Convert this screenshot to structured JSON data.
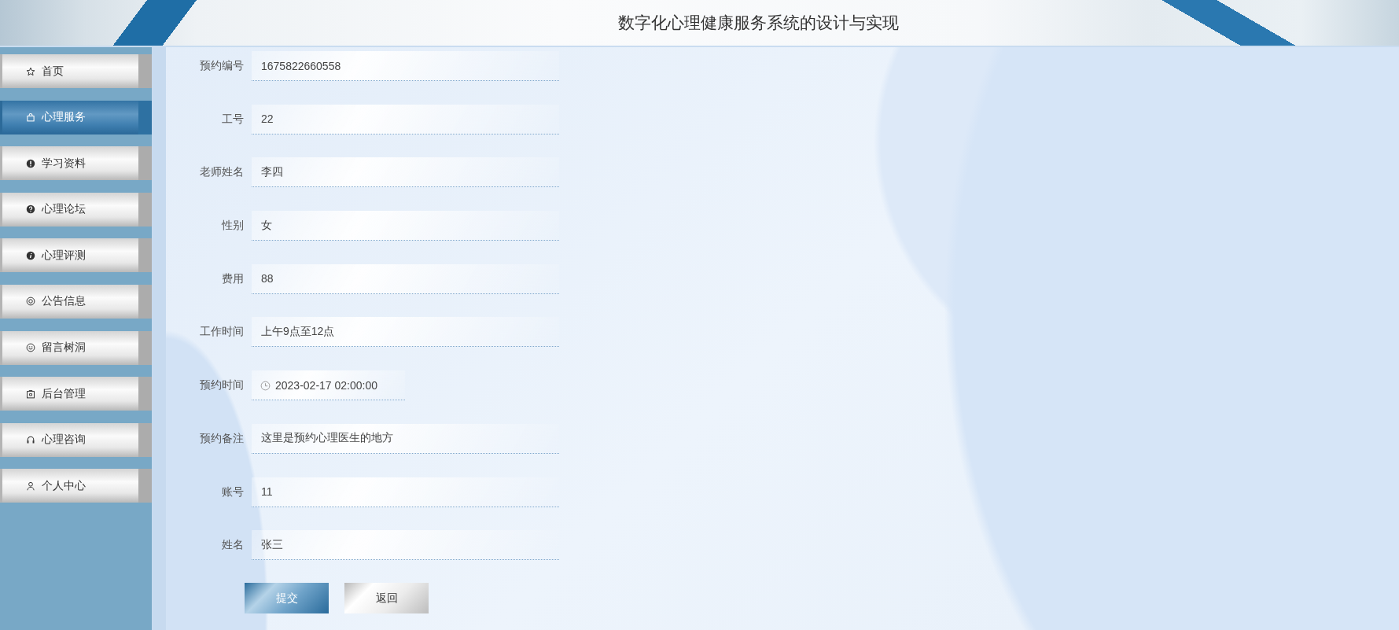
{
  "header": {
    "title": "数字化心理健康服务系统的设计与实现"
  },
  "sidebar": {
    "items": [
      {
        "label": "首页",
        "selected": false
      },
      {
        "label": "心理服务",
        "selected": true
      },
      {
        "label": "学习资料",
        "selected": false
      },
      {
        "label": "心理论坛",
        "selected": false
      },
      {
        "label": "心理评测",
        "selected": false
      },
      {
        "label": "公告信息",
        "selected": false
      },
      {
        "label": "留言树洞",
        "selected": false
      },
      {
        "label": "后台管理",
        "selected": false
      },
      {
        "label": "心理咨询",
        "selected": false
      },
      {
        "label": "个人中心",
        "selected": false
      }
    ]
  },
  "form": {
    "fields": [
      {
        "label": "预约编号",
        "kind": "text",
        "value": "1675822660558"
      },
      {
        "label": "工号",
        "kind": "text",
        "value": "22"
      },
      {
        "label": "老师姓名",
        "kind": "text",
        "value": "李四"
      },
      {
        "label": "性别",
        "kind": "text",
        "value": "女"
      },
      {
        "label": "费用",
        "kind": "text",
        "value": "88"
      },
      {
        "label": "工作时间",
        "kind": "text",
        "value": "上午9点至12点"
      },
      {
        "label": "预约时间",
        "kind": "datetime",
        "value": "2023-02-17 02:00:00"
      },
      {
        "label": "预约备注",
        "kind": "text",
        "value": "这里是预约心理医生的地方"
      },
      {
        "label": "账号",
        "kind": "text",
        "value": "11"
      },
      {
        "label": "姓名",
        "kind": "text",
        "value": "张三"
      }
    ],
    "buttons": [
      {
        "label": "提交",
        "kind": "primary"
      },
      {
        "label": "返回",
        "kind": "secondary"
      }
    ]
  }
}
